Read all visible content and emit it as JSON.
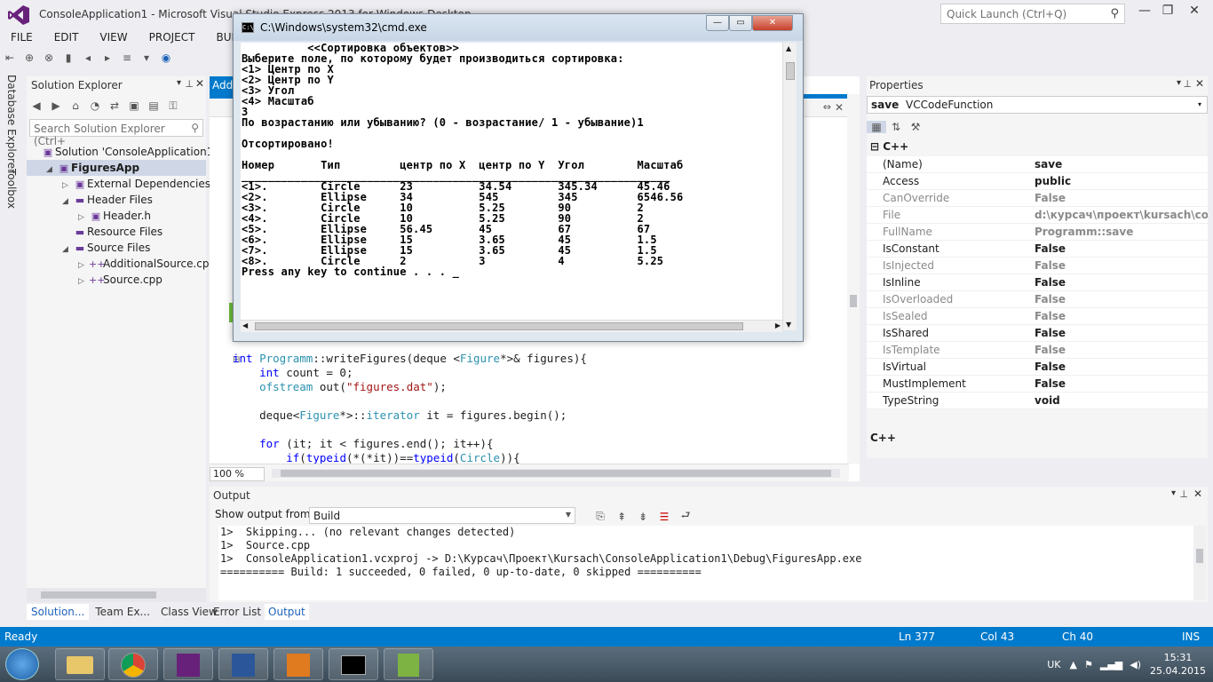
{
  "vs": {
    "title": "ConsoleApplication1 - Microsoft Visual Studio Express 2013 for Windows Desktop",
    "quick_launch": "Quick Launch (Ctrl+Q)",
    "menu": [
      "FILE",
      "EDIT",
      "VIEW",
      "PROJECT",
      "BUILD"
    ],
    "side_tabs": [
      "Database Explorer",
      "Toolbox"
    ],
    "solution_explorer": {
      "title": "Solution Explorer",
      "search": "Search Solution Explorer (Ctrl+",
      "tree": [
        {
          "label": "Solution 'ConsoleApplication1'",
          "depth": 0,
          "arrow": "",
          "icon": "solution-icon"
        },
        {
          "label": "FiguresApp",
          "depth": 1,
          "arrow": "◢",
          "icon": "project-icon",
          "selected": true
        },
        {
          "label": "External Dependencies",
          "depth": 2,
          "arrow": "▷",
          "icon": "dependencies-icon"
        },
        {
          "label": "Header Files",
          "depth": 2,
          "arrow": "◢",
          "icon": "folder-icon"
        },
        {
          "label": "Header.h",
          "depth": 3,
          "arrow": "▷",
          "icon": "header-file-icon"
        },
        {
          "label": "Resource Files",
          "depth": 2,
          "arrow": "",
          "icon": "folder-icon"
        },
        {
          "label": "Source Files",
          "depth": 2,
          "arrow": "◢",
          "icon": "folder-icon"
        },
        {
          "label": "AdditionalSource.cpp",
          "depth": 3,
          "arrow": "▷",
          "icon": "cpp-file-icon"
        },
        {
          "label": "Source.cpp",
          "depth": 3,
          "arrow": "▷",
          "icon": "cpp-file-icon"
        }
      ],
      "tabs": [
        "Solution...",
        "Team Ex...",
        "Class View"
      ]
    },
    "editor": {
      "tab": "Addi",
      "zoom": "100 %",
      "code": [
        [
          {
            "t": "int ",
            "c": "kw"
          },
          {
            "t": "Programm",
            "c": "ty"
          },
          {
            "t": "::writeFigures(deque <",
            "c": ""
          },
          {
            "t": "Figure",
            "c": "ty"
          },
          {
            "t": "*>& figures){",
            "c": ""
          }
        ],
        [
          {
            "t": "    ",
            "c": ""
          },
          {
            "t": "int",
            "c": "kw"
          },
          {
            "t": " count = 0;",
            "c": ""
          }
        ],
        [
          {
            "t": "    ",
            "c": ""
          },
          {
            "t": "ofstream",
            "c": "ty"
          },
          {
            "t": " out(",
            "c": ""
          },
          {
            "t": "\"figures.dat\"",
            "c": "st"
          },
          {
            "t": ");",
            "c": ""
          }
        ],
        [
          {
            "t": "",
            "c": ""
          }
        ],
        [
          {
            "t": "    deque<",
            "c": ""
          },
          {
            "t": "Figure",
            "c": "ty"
          },
          {
            "t": "*>::",
            "c": ""
          },
          {
            "t": "iterator",
            "c": "ty"
          },
          {
            "t": " it = figures.begin();",
            "c": ""
          }
        ],
        [
          {
            "t": "",
            "c": ""
          }
        ],
        [
          {
            "t": "    ",
            "c": ""
          },
          {
            "t": "for",
            "c": "kw"
          },
          {
            "t": " (it; it < figures.end(); it++){",
            "c": ""
          }
        ],
        [
          {
            "t": "        ",
            "c": ""
          },
          {
            "t": "if",
            "c": "kw"
          },
          {
            "t": "(",
            "c": ""
          },
          {
            "t": "typeid",
            "c": "kw"
          },
          {
            "t": "(*(*it))==",
            "c": ""
          },
          {
            "t": "typeid",
            "c": "kw"
          },
          {
            "t": "(",
            "c": ""
          },
          {
            "t": "Circle",
            "c": "ty"
          },
          {
            "t": ")){",
            "c": ""
          }
        ]
      ]
    },
    "properties": {
      "title": "Properties",
      "object_name": "save",
      "object_type": "VCCodeFunction",
      "category": "C++",
      "rows": [
        {
          "name": "(Name)",
          "value": "save",
          "disabled": false
        },
        {
          "name": "Access",
          "value": "public",
          "disabled": false
        },
        {
          "name": "CanOverride",
          "value": "False",
          "disabled": true
        },
        {
          "name": "File",
          "value": "d:\\курсач\\проект\\kursach\\console",
          "disabled": true
        },
        {
          "name": "FullName",
          "value": "Programm::save",
          "disabled": true
        },
        {
          "name": "IsConstant",
          "value": "False",
          "disabled": false
        },
        {
          "name": "IsInjected",
          "value": "False",
          "disabled": true
        },
        {
          "name": "IsInline",
          "value": "False",
          "disabled": false
        },
        {
          "name": "IsOverloaded",
          "value": "False",
          "disabled": true
        },
        {
          "name": "IsSealed",
          "value": "False",
          "disabled": true
        },
        {
          "name": "IsShared",
          "value": "False",
          "disabled": false
        },
        {
          "name": "IsTemplate",
          "value": "False",
          "disabled": true
        },
        {
          "name": "IsVirtual",
          "value": "False",
          "disabled": false
        },
        {
          "name": "MustImplement",
          "value": "False",
          "disabled": false
        },
        {
          "name": "TypeString",
          "value": "void",
          "disabled": false
        }
      ],
      "description": "C++"
    },
    "output": {
      "title": "Output",
      "show_from_label": "Show output from:",
      "show_from_value": "Build",
      "lines": [
        "1>  Skipping... (no relevant changes detected)",
        "1>  Source.cpp",
        "1>  ConsoleApplication1.vcxproj -> D:\\Курсач\\Проект\\Kursach\\ConsoleApplication1\\Debug\\FiguresApp.exe",
        "========== Build: 1 succeeded, 0 failed, 0 up-to-date, 0 skipped =========="
      ],
      "tabs": [
        "Error List",
        "Output"
      ]
    },
    "status": {
      "ready": "Ready",
      "line": "Ln 377",
      "col": "Col 43",
      "ch": "Ch 40",
      "mode": "INS"
    }
  },
  "cmd": {
    "title": "C:\\Windows\\system32\\cmd.exe",
    "lines": [
      "          <<Сортировка объектов>>",
      "Выберите поле, по которому будет производиться сортировка:",
      "<1> Центр по X",
      "<2> Центр по Y",
      "<3> Угол",
      "<4> Масштаб",
      "3",
      "По возрастанию или убыванию? (0 - возрастание/ 1 - убывание)1",
      "",
      "Отсортировано!",
      "",
      "Номер       Тип         центр по X  центр по Y  Угол        Масштаб",
      "_________________________________________________________________",
      "<1>.        Circle      23          34.54       345.34      45.46",
      "<2>.        Ellipse     34          545         345         6546.56",
      "<3>.        Circle      10          5.25        90          2",
      "<4>.        Circle      10          5.25        90          2",
      "<5>.        Ellipse     56.45       45          67          67",
      "<6>.        Ellipse     15          3.65        45          1.5",
      "<7>.        Ellipse     15          3.65        45          1.5",
      "<8>.        Circle      2           3           4           5.25",
      "Press any key to continue . . . _"
    ]
  },
  "tray": {
    "lang": "UK",
    "time": "15:31",
    "date": "25.04.2015"
  }
}
